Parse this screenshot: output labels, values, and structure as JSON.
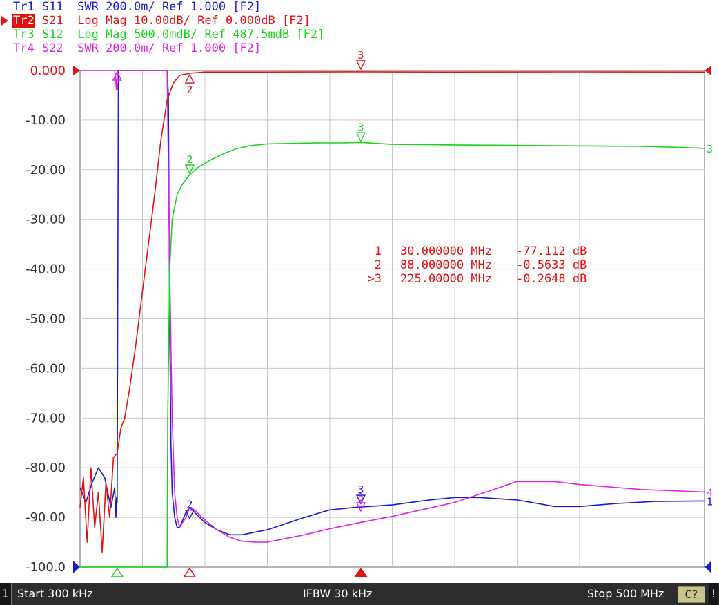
{
  "traces": [
    {
      "tag": "Tr1",
      "text": " S11  SWR 200.0m/ Ref 1.000 [F2]",
      "color": "#1a1ad4",
      "active": false
    },
    {
      "tag": "Tr2",
      "text": " S21  Log Mag 10.00dB/ Ref 0.000dB [F2]",
      "color": "#e31212",
      "active": true
    },
    {
      "tag": "Tr3",
      "text": " S12  Log Mag 500.0mdB/ Ref 487.5mdB [F2]",
      "color": "#18d418",
      "active": false
    },
    {
      "tag": "Tr4",
      "text": " S22  SWR 200.0m/ Ref 1.000 [F2]",
      "color": "#e020e0",
      "active": false
    }
  ],
  "markers_table": [
    {
      "id": "1",
      "freq": "30.000000 MHz",
      "value": "-77.112 dB"
    },
    {
      "id": "2",
      "freq": "88.000000 MHz",
      "value": "-0.5633 dB"
    },
    {
      "id": ">3",
      "freq": "225.00000 MHz",
      "value": "-0.2648 dB"
    }
  ],
  "status": {
    "channel": "1",
    "start": "Start 300 kHz",
    "ifbw": "IFBW 30 kHz",
    "stop": "Stop 500 MHz",
    "cal": "C?",
    "warn": "!"
  },
  "chart_data": {
    "type": "line",
    "title": "",
    "xlabel": "",
    "ylabel": "",
    "x_unit": "MHz",
    "xlim": [
      0.3,
      500
    ],
    "ylim": [
      -100,
      0
    ],
    "y_ticks": [
      "0.000",
      "-10.00",
      "-20.00",
      "-30.00",
      "-40.00",
      "-50.00",
      "-60.00",
      "-70.00",
      "-80.00",
      "-90.00",
      "-100.0"
    ],
    "grid": true,
    "series": [
      {
        "name": "Tr1 S11",
        "color": "#1a1ad4",
        "x": [
          0.3,
          5,
          10,
          15,
          20,
          25,
          28,
          29,
          29.5,
          30,
          31,
          35,
          60,
          70,
          71,
          72,
          73,
          74,
          76,
          78,
          80,
          85,
          88,
          92,
          100,
          110,
          120,
          130,
          140,
          150,
          180,
          200,
          220,
          250,
          280,
          300,
          320,
          350,
          380,
          400,
          430,
          460,
          500
        ],
        "y": [
          -84,
          -87,
          -83,
          -80,
          -82,
          -88,
          -84,
          -90,
          -86,
          -87,
          0,
          0,
          0,
          0,
          -5,
          -50,
          -75,
          -85,
          -90,
          -92,
          -92,
          -89,
          -88,
          -89,
          -91,
          -92.5,
          -93.5,
          -93.5,
          -93,
          -92.5,
          -90,
          -88.5,
          -88,
          -87.5,
          -86.5,
          -86,
          -86,
          -86.5,
          -87.8,
          -87.8,
          -87.2,
          -86.8,
          -86.7
        ],
        "end_label": "1"
      },
      {
        "name": "Tr2 S21",
        "color": "#e31212",
        "x": [
          0.3,
          3,
          6,
          9,
          12,
          15,
          18,
          21,
          24,
          27,
          30,
          33,
          36,
          40,
          45,
          50,
          55,
          60,
          65,
          70,
          75,
          80,
          88,
          100,
          150,
          225,
          300,
          400,
          500
        ],
        "y": [
          -88,
          -82,
          -95,
          -80,
          -92,
          -85,
          -97,
          -83,
          -90,
          -78,
          -77.1,
          -72,
          -70,
          -64,
          -55,
          -45,
          -35,
          -25,
          -14,
          -6,
          -2.5,
          -1,
          -0.56,
          -0.3,
          -0.3,
          -0.26,
          -0.3,
          -0.28,
          -0.3
        ],
        "end_label": ""
      },
      {
        "name": "Tr3 S12",
        "color": "#18d418",
        "x": [
          0.3,
          70,
          70.5,
          72,
          74,
          78,
          82,
          88,
          95,
          105,
          115,
          125,
          135,
          150,
          170,
          190,
          210,
          225,
          250,
          300,
          350,
          400,
          450,
          480,
          500
        ],
        "y": [
          -100,
          -100,
          -70,
          -40,
          -30,
          -25,
          -23,
          -21,
          -19.5,
          -18,
          -16.8,
          -15.8,
          -15.2,
          -14.8,
          -14.7,
          -14.6,
          -14.6,
          -14.5,
          -14.9,
          -15,
          -15.1,
          -15.2,
          -15.3,
          -15.5,
          -15.7
        ],
        "end_label": "3"
      },
      {
        "name": "Tr4 S22",
        "color": "#e020e0",
        "x": [
          0.3,
          28,
          29.5,
          30,
          31,
          70,
          72,
          74,
          76,
          78,
          80,
          85,
          88,
          92,
          100,
          110,
          120,
          130,
          140,
          150,
          180,
          200,
          225,
          250,
          300,
          330,
          350,
          380,
          400,
          450,
          500
        ],
        "y": [
          0,
          0,
          -4,
          0,
          0,
          0,
          -40,
          -70,
          -85,
          -90,
          -92,
          -90,
          -88,
          -88.5,
          -90.5,
          -92.5,
          -94,
          -94.8,
          -95,
          -95,
          -93.5,
          -92.3,
          -91,
          -89.8,
          -87,
          -84.5,
          -82.8,
          -82.8,
          -83.4,
          -84.4,
          -84.9
        ],
        "end_label": "4"
      }
    ],
    "trace_markers": [
      {
        "trace": "Tr2 S21",
        "label": "2",
        "x": 88,
        "y": -0.56
      },
      {
        "trace": "Tr2 S21",
        "label": "3",
        "x": 225,
        "y": 0
      },
      {
        "trace": "Tr3 S12",
        "label": "2",
        "x": 88,
        "y": -21
      },
      {
        "trace": "Tr3 S12",
        "label": "3",
        "x": 225,
        "y": -14.5
      },
      {
        "trace": "Tr4 S22",
        "label": "1",
        "x": 30,
        "y": 0
      },
      {
        "trace": "Tr1 S11",
        "label": "2",
        "x": 88,
        "y": -90.5
      },
      {
        "trace": "Tr1 S11",
        "label": "3",
        "x": 225,
        "y": -87.5
      },
      {
        "trace": "Tr4 S22",
        "label": "3",
        "x": 225,
        "y": -89
      }
    ]
  }
}
